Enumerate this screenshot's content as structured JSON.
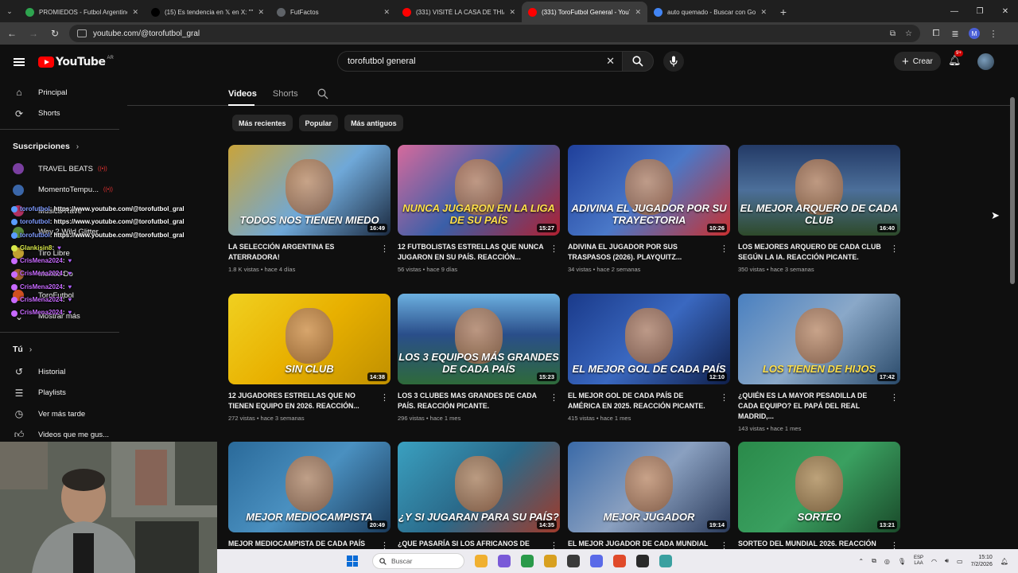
{
  "browser": {
    "tabs": [
      {
        "title": "PROMIEDOS - Futbol Argentino",
        "fav": "#2ea44f",
        "active": false
      },
      {
        "title": "(15) Es tendencia en 𝕏 en X: \"\"",
        "fav": "#000000",
        "active": false
      },
      {
        "title": "FutFactos",
        "fav": "#5f6368",
        "active": false
      },
      {
        "title": "(331) VISITÉ LA CASA DE THIAGO",
        "fav": "#ff0000",
        "active": false
      },
      {
        "title": "(331) ToroFutbol General - YouT",
        "fav": "#ff0000",
        "active": true
      },
      {
        "title": "auto quemado - Buscar con Goo",
        "fav": "#4285f4",
        "active": false
      }
    ],
    "url": "youtube.com/@torofutbol_gral",
    "profile_initial": "M"
  },
  "youtube": {
    "logo": "YouTube",
    "country": "AR",
    "search_value": "torofutbol general",
    "create_label": "Crear",
    "notif_badge": "9+"
  },
  "sidebar": {
    "main": [
      {
        "label": "Principal",
        "icon": "home-icon"
      },
      {
        "label": "Shorts",
        "icon": "shorts-icon"
      }
    ],
    "subs_title": "Suscripciones",
    "subs": [
      {
        "label": "TRAVEL BEATS",
        "color": "#7a3fa0"
      },
      {
        "label": "MomentoTempu...",
        "color": "#3a66a8"
      },
      {
        "label": "Música Rave",
        "color": "#b03060"
      },
      {
        "label": "Wey 2 Wild Glitter",
        "color": "#5a8a3a"
      },
      {
        "label": "Tiro Libre",
        "color": "#c0a030"
      },
      {
        "label": "Mundo Do",
        "color": "#a06030"
      },
      {
        "label": "ToroFutbol",
        "color": "#d05020"
      }
    ],
    "show_more": "Mostrar más",
    "you_title": "Tú",
    "you": [
      {
        "label": "Historial",
        "icon": "history-icon"
      },
      {
        "label": "Playlists",
        "icon": "playlist-icon"
      },
      {
        "label": "Ver más tarde",
        "icon": "watch-later-icon"
      },
      {
        "label": "Videos que me gus...",
        "icon": "like-icon"
      }
    ]
  },
  "chat": [
    {
      "user": "torofutbol",
      "text": ": https://www.youtube.com/@torofutbol_gral",
      "color": "n1"
    },
    {
      "user": "torofutbol",
      "text": ": https://www.youtube.com/@torofutbol_gral",
      "color": "n1"
    },
    {
      "user": "torofutbol",
      "text": ": https://www.youtube.com/@torofutbol_gral",
      "color": "n1"
    },
    {
      "user": "Glankisin8",
      "text": ":",
      "color": "n3"
    },
    {
      "user": "CrisMena2024",
      "text": ":",
      "color": "n2"
    },
    {
      "user": "CrisMena2024",
      "text": ":",
      "color": "n2"
    },
    {
      "user": "CrisMena2024",
      "text": ":",
      "color": "n2"
    },
    {
      "user": "CrisMena2024",
      "text": ":",
      "color": "n2"
    },
    {
      "user": "CrisMena2024",
      "text": ":",
      "color": "n2"
    }
  ],
  "channel": {
    "tabs": [
      "Videos",
      "Shorts"
    ],
    "chips": [
      "Más recientes",
      "Popular",
      "Más antiguos"
    ]
  },
  "videos": [
    {
      "title": "LA SELECCIÓN ARGENTINA ES ATERRADORA!",
      "meta": "1.8 K vistas • hace 4 días",
      "dur": "16:49",
      "cap": "TODOS NOS TIENEN MIEDO",
      "bg": "linear-gradient(135deg,#c9a43a 0%,#6fa8d8 55%,#1b2a40 100%)",
      "yel": false
    },
    {
      "title": "12 FUTBOLISTAS ESTRELLAS QUE NUNCA JUGARON EN SU PAÍS. REACCIÓN...",
      "meta": "56 vistas • hace 9 días",
      "dur": "15:27",
      "cap": "NUNCA JUGARON EN LA LIGA DE SU PAÍS",
      "bg": "linear-gradient(135deg,#d66a9c 0%,#3a5fa8 50%,#b02030 100%)",
      "yel": true
    },
    {
      "title": "ADIVINA EL JUGADOR POR SUS TRASPASOS (2026). PLAYQUITZ...",
      "meta": "34 vistas • hace 2 semanas",
      "dur": "10:26",
      "cap": "ADIVINA EL JUGADOR POR SU TRAYECTORIA",
      "bg": "linear-gradient(135deg,#1f3f9a 0%,#4a78c8 50%,#c83030 100%)",
      "yel": false
    },
    {
      "title": "LOS MEJORES ARQUERO DE CADA CLUB SEGÚN LA IA. REACCIÓN PICANTE.",
      "meta": "350 vistas • hace 3 semanas",
      "dur": "16:40",
      "cap": "EL MEJOR ARQUERO DE CADA CLUB",
      "bg": "linear-gradient(180deg,#233a66 0%,#4c6f9a 50%,#2e4a2a 100%)",
      "yel": false
    },
    {
      "title": "12 JUGADORES ESTRELLAS QUE NO TIENEN EQUIPO EN 2026. REACCIÓN...",
      "meta": "272 vistas • hace 3 semanas",
      "dur": "14:38",
      "cap": "SIN CLUB",
      "bg": "linear-gradient(135deg,#f0d020 0%,#e8b000 50%,#c09000 100%)",
      "yel": false
    },
    {
      "title": "LOS 3 CLUBES MAS GRANDES DE CADA PAÍS. REACCIÓN PICANTE.",
      "meta": "296 vistas • hace 1 mes",
      "dur": "15:23",
      "cap": "LOS 3 EQUIPOS MÁS GRANDES DE CADA PAÍS",
      "bg": "linear-gradient(180deg,#6cb0e0 0%,#2a4e8a 45%,#2e6a3a 100%)",
      "yel": false
    },
    {
      "title": "EL MEJOR GOL DE CADA PAÍS DE AMÉRICA EN 2025. REACCIÓN PICANTE.",
      "meta": "415 vistas • hace 1 mes",
      "dur": "12:10",
      "cap": "EL MEJOR GOL DE CADA PAÍS",
      "bg": "linear-gradient(135deg,#1a3a8a 0%,#3a68c0 50%,#0f1f4a 100%)",
      "yel": false
    },
    {
      "title": "¿QUIÉN ES LA MAYOR PESADILLA DE CADA EQUIPO? EL PAPÁ DEL REAL MADRID,...",
      "meta": "143 vistas • hace 1 mes",
      "dur": "17:42",
      "cap": "LOS TIENEN DE HIJOS",
      "bg": "linear-gradient(135deg,#4a80c0 0%,#8aa8c8 50%,#2a4a6a 100%)",
      "yel": true
    },
    {
      "title": "MEJOR MEDIOCAMPISTA DE CADA PAÍS",
      "meta": "",
      "dur": "20:49",
      "cap": "MEJOR MEDIOCAMPISTA",
      "bg": "linear-gradient(135deg,#2a6a9a 0%,#4a90c0 50%,#1a3a5a 100%)",
      "yel": false
    },
    {
      "title": "¿QUE PASARÍA SI LOS AFRICANOS DE",
      "meta": "",
      "dur": "14:35",
      "cap": "¿Y SI JUGARAN PARA SU PAÍS?",
      "bg": "linear-gradient(135deg,#3aa0c0 0%,#2a6a8a 50%,#a03a2a 100%)",
      "yel": false
    },
    {
      "title": "EL MEJOR JUGADOR DE CADA MUNDIAL",
      "meta": "",
      "dur": "19:14",
      "cap": "MEJOR JUGADOR",
      "bg": "linear-gradient(135deg,#3a6aa8 0%,#8aa0c0 50%,#2a3a5a 100%)",
      "yel": false
    },
    {
      "title": "SORTEO DEL MUNDIAL 2026. REACCIÓN DE",
      "meta": "",
      "dur": "13:21",
      "cap": "SORTEO",
      "bg": "linear-gradient(135deg,#2a8a4a 0%,#3aa060 50%,#1a4a2a 100%)",
      "yel": false
    }
  ],
  "taskbar": {
    "search_placeholder": "Buscar",
    "apps": [
      "#f0b030",
      "#7a5ad8",
      "#2a9a4a",
      "#d8a020",
      "#3a3a3a",
      "#5a6ae8",
      "#e04a2a",
      "#2a2a2a",
      "#3aa0a0"
    ],
    "lang_top": "ESP",
    "lang_bottom": "LAA",
    "time": "15:10",
    "date": "7/2/2026"
  }
}
